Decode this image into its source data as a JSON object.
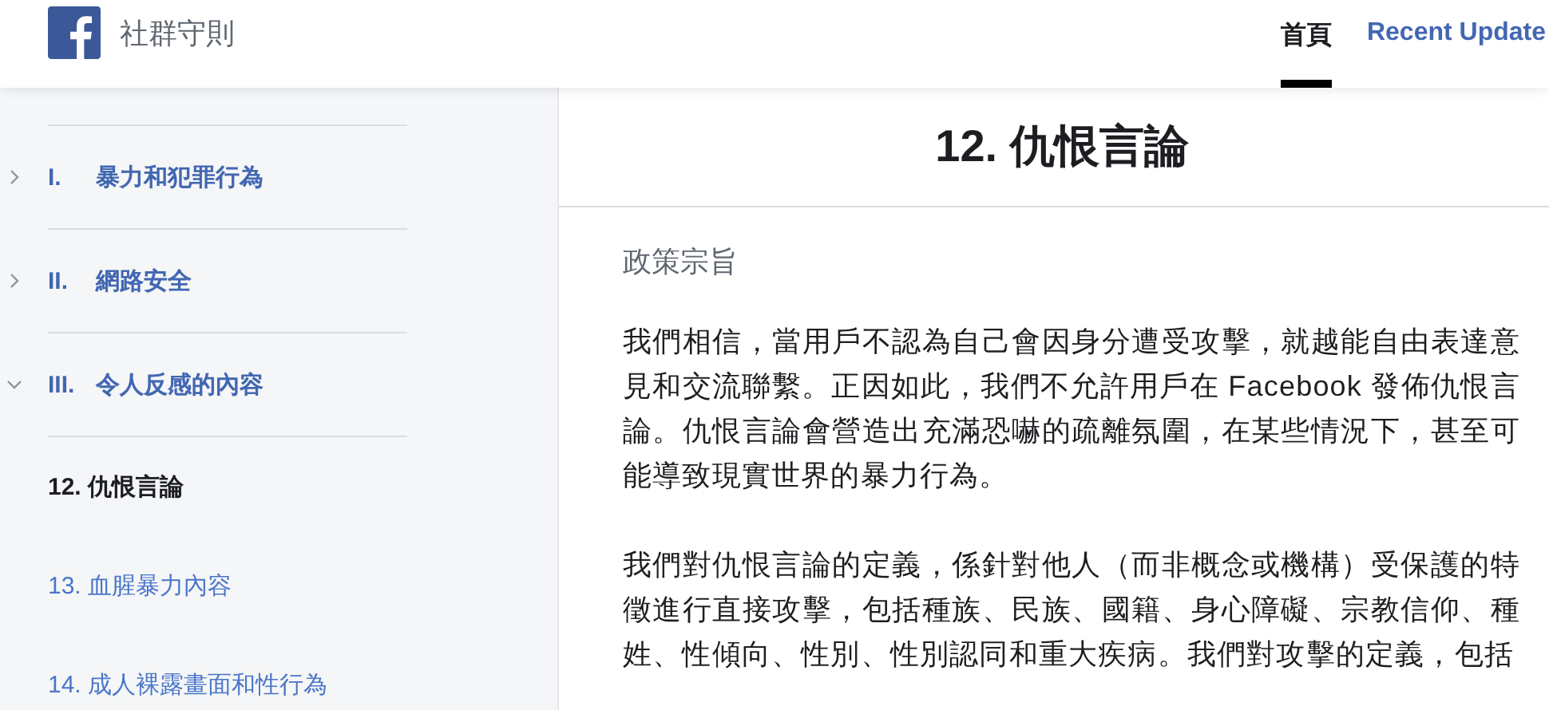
{
  "header": {
    "title": "社群守則",
    "nav": [
      {
        "label": "首頁",
        "selected": true
      },
      {
        "label": "Recent Update",
        "selected": false
      }
    ]
  },
  "sidebar": {
    "sections": [
      {
        "numeral": "I.",
        "label": "暴力和犯罪行為",
        "expanded": false
      },
      {
        "numeral": "II.",
        "label": "網路安全",
        "expanded": false
      },
      {
        "numeral": "III.",
        "label": "令人反感的內容",
        "expanded": true,
        "children": [
          {
            "label": "12. 仇恨言論",
            "selected": true
          },
          {
            "label": "13. 血腥暴力內容",
            "selected": false
          },
          {
            "label": "14. 成人裸露畫面和性行為",
            "selected": false
          }
        ]
      }
    ]
  },
  "article": {
    "title": "12. 仇恨言論",
    "heading": "政策宗旨",
    "paragraphs": [
      "我們相信，當用戶不認為自己會因身分遭受攻擊，就越能自由表達意見和交流聯繫。正因如此，我們不允許用戶在 Facebook 發佈仇恨言論。仇恨言論會營造出充滿恐嚇的疏離氛圍，在某些情況下，甚至可能導致現實世界的暴力行為。",
      "我們對仇恨言論的定義，係針對他人（而非概念或機構）受保護的特徵進行直接攻擊，包括種族、民族、國籍、身心障礙、宗教信仰、種姓、性傾向、性別、性別認同和重大疾病。我們對攻擊的定義，包括"
    ]
  }
}
